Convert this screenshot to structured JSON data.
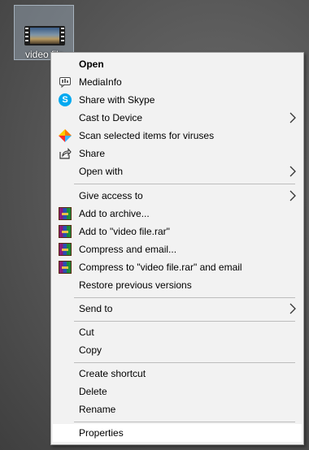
{
  "desktop": {
    "icon_label": "video file"
  },
  "menu": {
    "open": "Open",
    "mediainfo": "MediaInfo",
    "share_skype": "Share with Skype",
    "cast": "Cast to Device",
    "scan": "Scan selected items for viruses",
    "share": "Share",
    "open_with": "Open with",
    "give_access": "Give access to",
    "add_archive": "Add to archive...",
    "add_rar": "Add to \"video file.rar\"",
    "compress_email": "Compress and email...",
    "compress_rar_email": "Compress to \"video file.rar\" and email",
    "restore": "Restore previous versions",
    "send_to": "Send to",
    "cut": "Cut",
    "copy": "Copy",
    "create_shortcut": "Create shortcut",
    "delete": "Delete",
    "rename": "Rename",
    "properties": "Properties"
  },
  "icons": {
    "mediainfo": "mediainfo-icon",
    "skype": "skype-icon",
    "avast": "antivirus-icon",
    "share": "share-icon",
    "winrar": "winrar-icon",
    "submenu": "chevron-right-icon"
  },
  "colors": {
    "menu_bg": "#f2f2f2",
    "hover_bg": "#ffffff",
    "separator": "#bdbdbd",
    "skype_blue": "#00a9f0"
  }
}
